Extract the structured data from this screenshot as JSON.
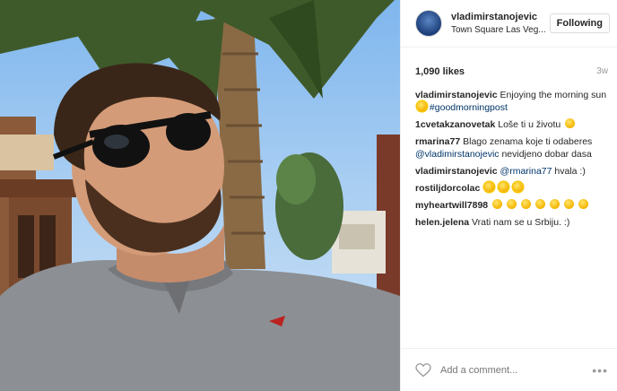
{
  "header": {
    "username": "vladimirstanojevic",
    "location": "Town Square Las Veg...",
    "follow_label": "Following"
  },
  "stats": {
    "likes": "1,090 likes",
    "time": "3w"
  },
  "caption": {
    "user": "vladimirstanojevic",
    "text": "Enjoying the morning sun",
    "hashtag": "#goodmorningpost"
  },
  "comments": [
    {
      "user": "1cvetakzanovetak",
      "text": "Loše ti u životu"
    },
    {
      "user": "rmarina77",
      "text": "Blago zenama koje ti odaberes",
      "mention": "@vladimirstanojevic",
      "tail": "nevidjeno dobar dasa"
    },
    {
      "user": "vladimirstanojevic",
      "mention": "@rmarina77",
      "tail": "hvala :)"
    },
    {
      "user": "rostiljdorcolac",
      "emoji_count": 3
    },
    {
      "user": "myheartwill7898",
      "emoji_count": 7
    },
    {
      "user": "helen.jelena",
      "text": "Vrati nam se u Srbiju. :)"
    }
  ],
  "footer": {
    "placeholder": "Add a comment...",
    "more": "•••"
  },
  "icons": {
    "like": "heart-icon",
    "more": "more-options-icon",
    "sun_emoji": "sun-emoji-icon"
  },
  "colors": {
    "link": "#003569",
    "border": "#efefef",
    "muted": "#999999"
  }
}
